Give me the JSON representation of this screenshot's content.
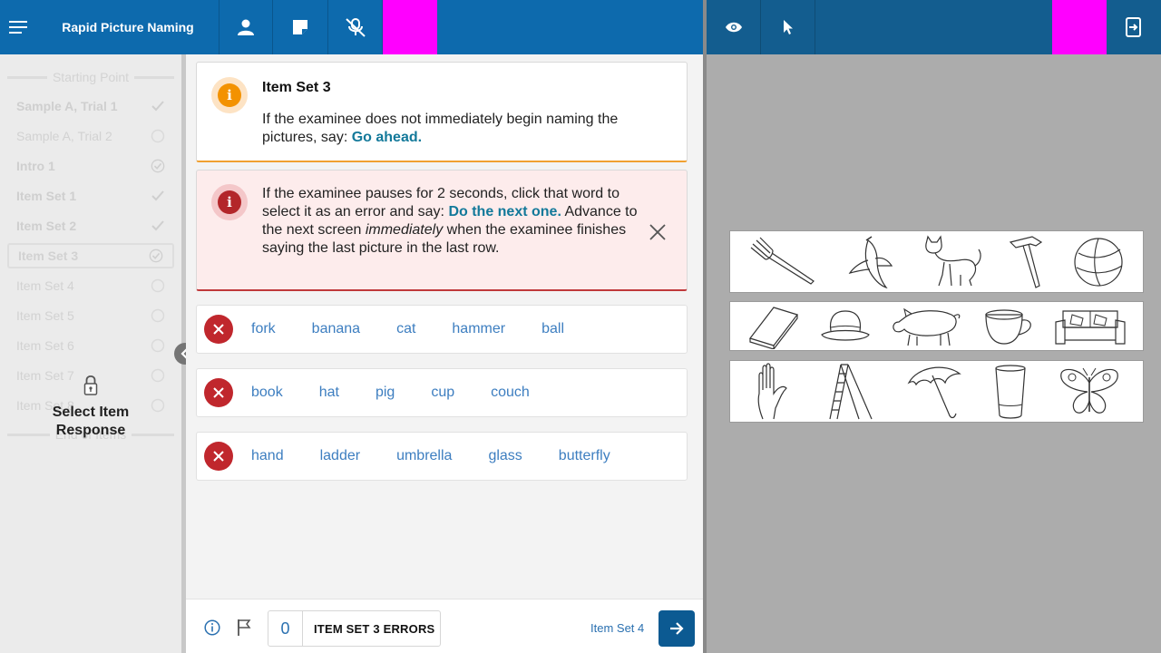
{
  "header": {
    "menu_icon": "hamburger-menu-icon",
    "app_title": "Rapid Picture Naming",
    "buttons": [
      "person-icon",
      "note-icon",
      "microphone-muted-icon"
    ],
    "right_buttons": [
      "eye-icon",
      "cursor-icon",
      "exit-to-device-icon"
    ],
    "accent_color": "#ff00ff"
  },
  "sidebar": {
    "start_label": "Starting Point",
    "end_label": "End of Items",
    "items": [
      {
        "label": "Sample A, Trial 1",
        "status": "check"
      },
      {
        "label": "Sample A, Trial 2",
        "status": "empty"
      },
      {
        "label": "Intro 1",
        "status": "check-circle"
      },
      {
        "label": "Item Set 1",
        "status": "check"
      },
      {
        "label": "Item Set 2",
        "status": "check"
      },
      {
        "label": "Item Set 3",
        "status": "current"
      },
      {
        "label": "Item Set 4",
        "status": "empty"
      },
      {
        "label": "Item Set 5",
        "status": "empty"
      },
      {
        "label": "Item Set 6",
        "status": "empty"
      },
      {
        "label": "Item Set 7",
        "status": "empty"
      },
      {
        "label": "Item Set 8",
        "status": "empty"
      }
    ],
    "locked_message": "Select Item Response"
  },
  "instructions": {
    "title": "Item Set 3",
    "text_1": "If the examinee does not immediately begin naming the pictures, say: ",
    "prompt_1": "Go ahead.",
    "warn_a": "If the examinee pauses for 2 seconds, click that word to select it as an error and say: ",
    "warn_prompt": "Do the next one.",
    "warn_b": " Advance to the next screen ",
    "warn_em": "immediately",
    "warn_c": " when the examinee finishes saying the last picture in the last row."
  },
  "rows": [
    {
      "words": [
        "fork",
        "banana",
        "cat",
        "hammer",
        "ball"
      ]
    },
    {
      "words": [
        "book",
        "hat",
        "pig",
        "cup",
        "couch"
      ]
    },
    {
      "words": [
        "hand",
        "ladder",
        "umbrella",
        "glass",
        "butterfly"
      ]
    }
  ],
  "footer": {
    "error_count": "0",
    "error_label": "ITEM SET 3 ERRORS",
    "next_label": "Item Set 4"
  },
  "stimulus": {
    "rows": [
      [
        "fork",
        "banana",
        "cat",
        "hammer",
        "ball"
      ],
      [
        "book",
        "hat",
        "pig",
        "cup",
        "couch"
      ],
      [
        "hand",
        "ladder",
        "umbrella",
        "glass",
        "butterfly"
      ]
    ]
  }
}
